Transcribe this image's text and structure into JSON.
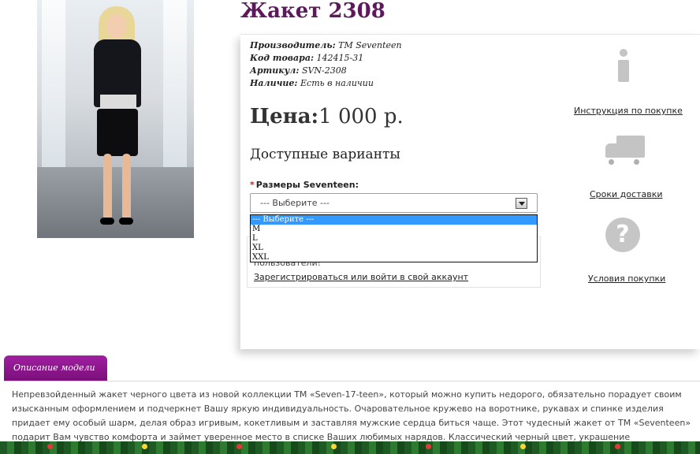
{
  "product": {
    "title": "Жакет 2308",
    "manufacturer_label": "Производитель:",
    "manufacturer": "ТМ Seventeen",
    "code_label": "Код товара:",
    "code": "142415-31",
    "article_label": "Артикул:",
    "article": "SVN-2308",
    "availability_label": "Наличие:",
    "availability": "Есть в наличии",
    "price_label": "Цена:",
    "price": "1 000 р."
  },
  "options": {
    "heading": "Доступные варианты",
    "size_label": "Размеры Seventeen:",
    "required_mark": "*",
    "select_value": "--- Выберите ---",
    "list": [
      "--- Выберите ---",
      "M",
      "L",
      "XL",
      "XXL"
    ]
  },
  "notice": {
    "text": "пользователи!",
    "link": "Зарегистрироваться или войти в свой аккаунт"
  },
  "sidebar": {
    "instruction_link": "Инструкция по покупке",
    "delivery_link": "Сроки доставки",
    "terms_link": "Условия покупки"
  },
  "description": {
    "tab_label": "Описание модели",
    "text": "Непревзойденный жакет черного цвета из новой коллекции ТМ «Seven-17-teen», который можно купить недорого, обязательно порадует своим изысканным оформлением и подчеркнет Вашу яркую индивидуальность. Очаровательное кружево на воротнике, рукавах и спинке изделия придает ему особый шарм, делая образ игривым, кокетливым и заставляя мужские сердца биться чаще. Этот чудесный жакет от ТМ «Seventeen» подарит Вам чувство комфорта и займет уверенное место в списке Ваших любимых нарядов. Классический черный цвет, украшение ненавязчивыми пуговичками – Вы смело сможете надевать эту"
  },
  "colors": {
    "title": "#5c1a5c",
    "tab": "#8f178f",
    "listbox_selected": "#3399ff"
  }
}
